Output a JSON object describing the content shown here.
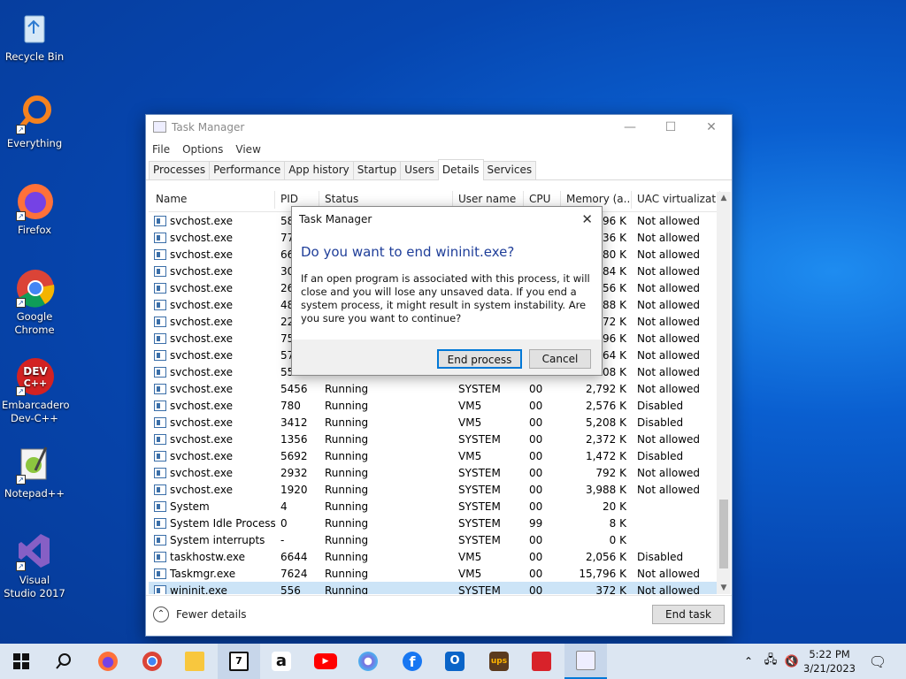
{
  "desktop": {
    "icons": [
      {
        "label": "Recycle Bin"
      },
      {
        "label": "Everything"
      },
      {
        "label": "Firefox"
      },
      {
        "label": "Google Chrome"
      },
      {
        "label": "Embarcadero Dev-C++"
      },
      {
        "label": "Notepad++"
      },
      {
        "label": "Visual Studio 2017"
      }
    ]
  },
  "task_manager": {
    "title": "Task Manager",
    "menu": [
      "File",
      "Options",
      "View"
    ],
    "tabs": [
      "Processes",
      "Performance",
      "App history",
      "Startup",
      "Users",
      "Details",
      "Services"
    ],
    "active_tab": "Details",
    "columns": [
      "Name",
      "PID",
      "Status",
      "User name",
      "CPU",
      "Memory (a...",
      "UAC virtualizat..."
    ],
    "rows": [
      {
        "name": "svchost.exe",
        "pid": "58",
        "status": "",
        "user": "",
        "cpu": "",
        "mem": "96 K",
        "uac": "Not allowed"
      },
      {
        "name": "svchost.exe",
        "pid": "77",
        "status": "",
        "user": "",
        "cpu": "",
        "mem": "36 K",
        "uac": "Not allowed"
      },
      {
        "name": "svchost.exe",
        "pid": "66",
        "status": "",
        "user": "",
        "cpu": "",
        "mem": "80 K",
        "uac": "Not allowed"
      },
      {
        "name": "svchost.exe",
        "pid": "30",
        "status": "",
        "user": "",
        "cpu": "",
        "mem": "84 K",
        "uac": "Not allowed"
      },
      {
        "name": "svchost.exe",
        "pid": "26",
        "status": "",
        "user": "",
        "cpu": "",
        "mem": "56 K",
        "uac": "Not allowed"
      },
      {
        "name": "svchost.exe",
        "pid": "48",
        "status": "",
        "user": "",
        "cpu": "",
        "mem": "88 K",
        "uac": "Not allowed"
      },
      {
        "name": "svchost.exe",
        "pid": "22",
        "status": "",
        "user": "",
        "cpu": "",
        "mem": "72 K",
        "uac": "Not allowed"
      },
      {
        "name": "svchost.exe",
        "pid": "75",
        "status": "",
        "user": "",
        "cpu": "",
        "mem": "96 K",
        "uac": "Not allowed"
      },
      {
        "name": "svchost.exe",
        "pid": "57",
        "status": "",
        "user": "",
        "cpu": "",
        "mem": "64 K",
        "uac": "Not allowed"
      },
      {
        "name": "svchost.exe",
        "pid": "55",
        "status": "",
        "user": "",
        "cpu": "",
        "mem": "08 K",
        "uac": "Not allowed"
      },
      {
        "name": "svchost.exe",
        "pid": "5456",
        "status": "Running",
        "user": "SYSTEM",
        "cpu": "00",
        "mem": "2,792 K",
        "uac": "Not allowed"
      },
      {
        "name": "svchost.exe",
        "pid": "780",
        "status": "Running",
        "user": "VM5",
        "cpu": "00",
        "mem": "2,576 K",
        "uac": "Disabled"
      },
      {
        "name": "svchost.exe",
        "pid": "3412",
        "status": "Running",
        "user": "VM5",
        "cpu": "00",
        "mem": "5,208 K",
        "uac": "Disabled"
      },
      {
        "name": "svchost.exe",
        "pid": "1356",
        "status": "Running",
        "user": "SYSTEM",
        "cpu": "00",
        "mem": "2,372 K",
        "uac": "Not allowed"
      },
      {
        "name": "svchost.exe",
        "pid": "5692",
        "status": "Running",
        "user": "VM5",
        "cpu": "00",
        "mem": "1,472 K",
        "uac": "Disabled"
      },
      {
        "name": "svchost.exe",
        "pid": "2932",
        "status": "Running",
        "user": "SYSTEM",
        "cpu": "00",
        "mem": "792 K",
        "uac": "Not allowed"
      },
      {
        "name": "svchost.exe",
        "pid": "1920",
        "status": "Running",
        "user": "SYSTEM",
        "cpu": "00",
        "mem": "3,988 K",
        "uac": "Not allowed"
      },
      {
        "name": "System",
        "pid": "4",
        "status": "Running",
        "user": "SYSTEM",
        "cpu": "00",
        "mem": "20 K",
        "uac": ""
      },
      {
        "name": "System Idle Process",
        "pid": "0",
        "status": "Running",
        "user": "SYSTEM",
        "cpu": "99",
        "mem": "8 K",
        "uac": ""
      },
      {
        "name": "System interrupts",
        "pid": "-",
        "status": "Running",
        "user": "SYSTEM",
        "cpu": "00",
        "mem": "0 K",
        "uac": ""
      },
      {
        "name": "taskhostw.exe",
        "pid": "6644",
        "status": "Running",
        "user": "VM5",
        "cpu": "00",
        "mem": "2,056 K",
        "uac": "Disabled"
      },
      {
        "name": "Taskmgr.exe",
        "pid": "7624",
        "status": "Running",
        "user": "VM5",
        "cpu": "00",
        "mem": "15,796 K",
        "uac": "Not allowed"
      },
      {
        "name": "wininit.exe",
        "pid": "556",
        "status": "Running",
        "user": "SYSTEM",
        "cpu": "00",
        "mem": "372 K",
        "uac": "Not allowed"
      }
    ],
    "fewer_details": "Fewer details",
    "end_task": "End task"
  },
  "dialog": {
    "title": "Task Manager",
    "question": "Do you want to end wininit.exe?",
    "message": "If an open program is associated with this process, it will close and you will lose any unsaved data. If you end a system process, it might result in system instability. Are you sure you want to continue?",
    "end_process": "End process",
    "cancel": "Cancel"
  },
  "taskbar": {
    "time": "5:22 PM",
    "date": "3/21/2023",
    "icons": [
      "windows-start-icon",
      "search-icon",
      "firefox-icon",
      "chrome-icon",
      "file-explorer-icon",
      "taskmgr-app-icon",
      "amazon-icon",
      "youtube-icon",
      "bluesky-icon",
      "facebook-icon",
      "outlook-icon",
      "ups-icon",
      "bank-of-america-icon",
      "task-manager-icon"
    ]
  },
  "colors": {
    "accent": "#0078d7",
    "dialog_heading": "#1f3e99",
    "selected_row": "#cce4f7"
  }
}
